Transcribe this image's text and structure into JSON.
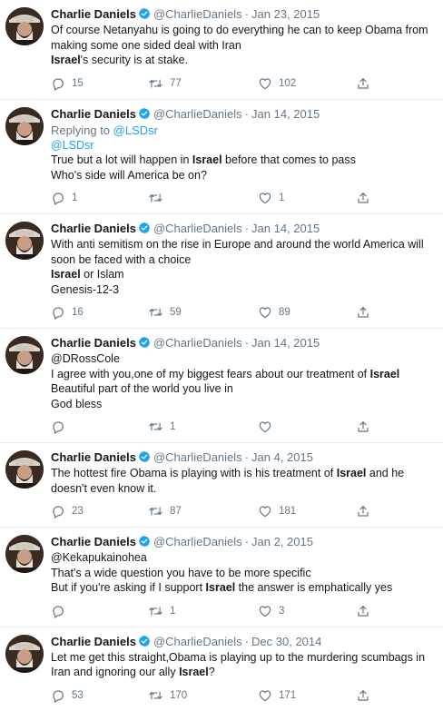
{
  "colors": {
    "link": "#1da1f2",
    "muted": "#657786",
    "text": "#14171a",
    "verified": "#1da1f2",
    "divider": "#e6ecf0"
  },
  "icons": {
    "reply": "speech-bubble-icon",
    "retweet": "retweet-arrows-icon",
    "like": "heart-outline-icon",
    "share": "share-upload-icon",
    "verified": "verified-badge-icon"
  },
  "tweets": [
    {
      "name": "Charlie Daniels",
      "handle": "@CharlieDaniels",
      "sep": "·",
      "date": "Jan 23, 2015",
      "lines": [
        [
          {
            "t": "Of course Netanyahu is going to do everything he can to keep Obama from"
          }
        ],
        [
          {
            "t": "making some one sided deal with Iran"
          }
        ],
        [
          {
            "t": "Israel",
            "s": "hl"
          },
          {
            "t": "'s security is at stake."
          }
        ]
      ],
      "replies": "15",
      "retweets": "77",
      "likes": "102"
    },
    {
      "name": "Charlie Daniels",
      "handle": "@CharlieDaniels",
      "sep": "·",
      "date": "Jan 14, 2015",
      "reply_label": "Replying to",
      "reply_target": "@LSDsr",
      "lines": [
        [
          {
            "t": "@LSDsr",
            "s": "mention"
          }
        ],
        [
          {
            "t": "True but a lot will happen in "
          },
          {
            "t": "Israel",
            "s": "hl"
          },
          {
            "t": " before that comes to pass"
          }
        ],
        [
          {
            "t": "Who's side will America be on?"
          }
        ]
      ],
      "replies": "1",
      "retweets": "",
      "likes": "1"
    },
    {
      "name": "Charlie Daniels",
      "handle": "@CharlieDaniels",
      "sep": "·",
      "date": "Jan 14, 2015",
      "lines": [
        [
          {
            "t": "With anti semitism on the rise in Europe and around the world America will"
          }
        ],
        [
          {
            "t": "soon be faced with a choice"
          }
        ],
        [
          {
            "t": "Israel",
            "s": "hl"
          },
          {
            "t": " or Islam"
          }
        ],
        [
          {
            "t": "Genesis-12-3"
          }
        ]
      ],
      "replies": "16",
      "retweets": "59",
      "likes": "89"
    },
    {
      "name": "Charlie Daniels",
      "handle": "@CharlieDaniels",
      "sep": "·",
      "date": "Jan 14, 2015",
      "lines": [
        [
          {
            "t": "@DRossCole"
          }
        ],
        [
          {
            "t": "I agree with you,one of my biggest fears about our treatment of "
          },
          {
            "t": "Israel",
            "s": "hl"
          }
        ],
        [
          {
            "t": "Beautiful part of the world you live in"
          }
        ],
        [
          {
            "t": "God bless"
          }
        ]
      ],
      "replies": "",
      "retweets": "1",
      "likes": ""
    },
    {
      "name": "Charlie Daniels",
      "handle": "@CharlieDaniels",
      "sep": "·",
      "date": "Jan 4, 2015",
      "lines": [
        [
          {
            "t": "The hottest fire Obama is playing with is his treatment of "
          },
          {
            "t": "Israel",
            "s": "hl"
          },
          {
            "t": " and he"
          }
        ],
        [
          {
            "t": "doesn't even know it."
          }
        ]
      ],
      "replies": "23",
      "retweets": "87",
      "likes": "181"
    },
    {
      "name": "Charlie Daniels",
      "handle": "@CharlieDaniels",
      "sep": "·",
      "date": "Jan 2, 2015",
      "lines": [
        [
          {
            "t": "@Kekapukainohea"
          }
        ],
        [
          {
            "t": "That's a wide question you have to be more specific"
          }
        ],
        [
          {
            "t": "But if you're asking if I support "
          },
          {
            "t": "Israel",
            "s": "hl"
          },
          {
            "t": " the answer is emphatically yes"
          }
        ]
      ],
      "replies": "",
      "retweets": "1",
      "likes": "3"
    },
    {
      "name": "Charlie Daniels",
      "handle": "@CharlieDaniels",
      "sep": "·",
      "date": "Dec 30, 2014",
      "lines": [
        [
          {
            "t": "Let me get this straight,Obama is playing up to the murdering scumbags in"
          }
        ],
        [
          {
            "t": "Iran and ignoring our ally "
          },
          {
            "t": "Israel",
            "s": "hl"
          },
          {
            "t": "?"
          }
        ]
      ],
      "replies": "53",
      "retweets": "170",
      "likes": "171"
    }
  ]
}
